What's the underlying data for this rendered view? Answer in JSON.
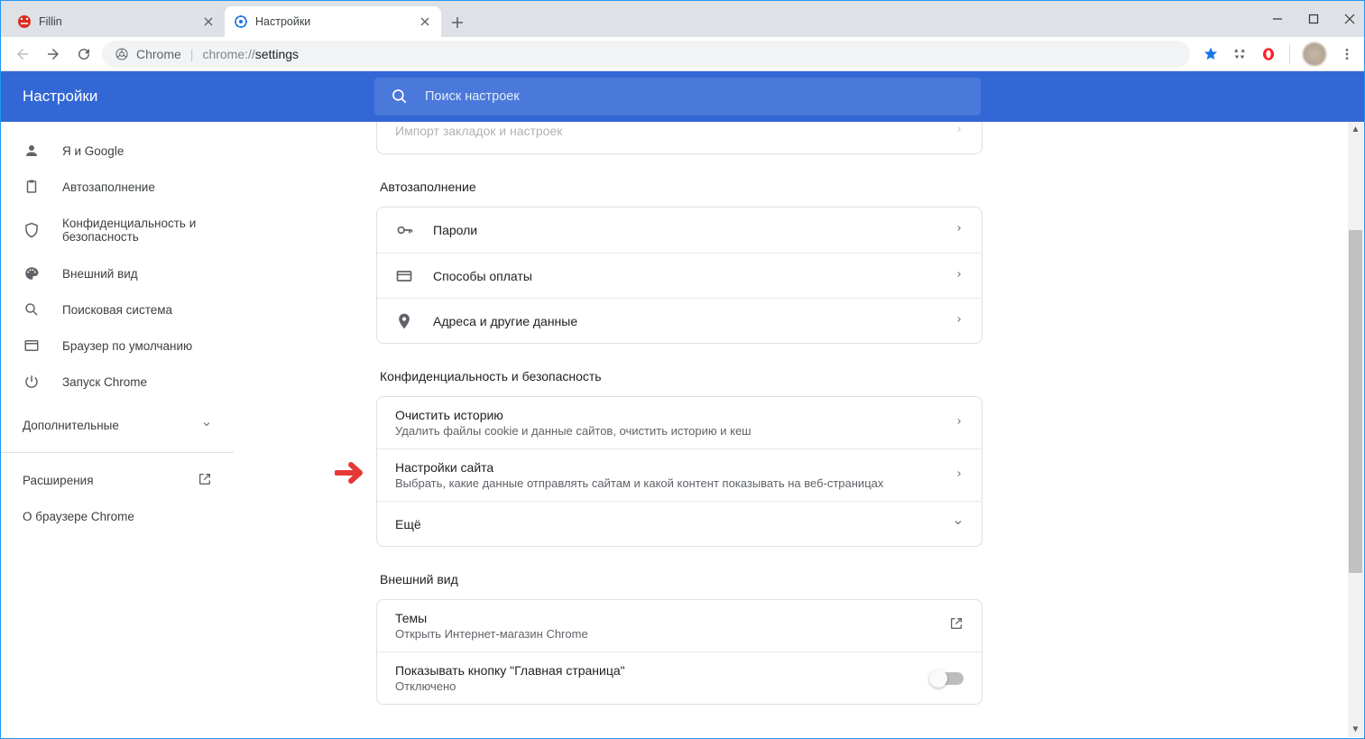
{
  "window": {
    "tabs": [
      {
        "title": "Fillin",
        "active": false
      },
      {
        "title": "Настройки",
        "active": true
      }
    ]
  },
  "toolbar": {
    "chrome_label": "Chrome",
    "url_prefix": "chrome://",
    "url_path": "settings"
  },
  "settings": {
    "title": "Настройки",
    "search_placeholder": "Поиск настроек",
    "sidebar": {
      "items": [
        {
          "label": "Я и Google"
        },
        {
          "label": "Автозаполнение"
        },
        {
          "label": "Конфиденциальность и безопасность"
        },
        {
          "label": "Внешний вид"
        },
        {
          "label": "Поисковая система"
        },
        {
          "label": "Браузер по умолчанию"
        },
        {
          "label": "Запуск Chrome"
        }
      ],
      "additional": "Дополнительные",
      "extensions": "Расширения",
      "about": "О браузере Chrome"
    },
    "main": {
      "truncated_row": "Импорт закладок и настроек",
      "section_autofill": {
        "title": "Автозаполнение",
        "rows": [
          {
            "label": "Пароли"
          },
          {
            "label": "Способы оплаты"
          },
          {
            "label": "Адреса и другие данные"
          }
        ]
      },
      "section_privacy": {
        "title": "Конфиденциальность и безопасность",
        "rows": [
          {
            "label": "Очистить историю",
            "desc": "Удалить файлы cookie и данные сайтов, очистить историю и кеш"
          },
          {
            "label": "Настройки сайта",
            "desc": "Выбрать, какие данные отправлять сайтам и какой контент показывать на веб-страницах"
          },
          {
            "label": "Ещё"
          }
        ]
      },
      "section_appearance": {
        "title": "Внешний вид",
        "rows": [
          {
            "label": "Темы",
            "desc": "Открыть Интернет-магазин Chrome"
          },
          {
            "label": "Показывать кнопку \"Главная страница\"",
            "desc": "Отключено"
          }
        ]
      }
    }
  }
}
